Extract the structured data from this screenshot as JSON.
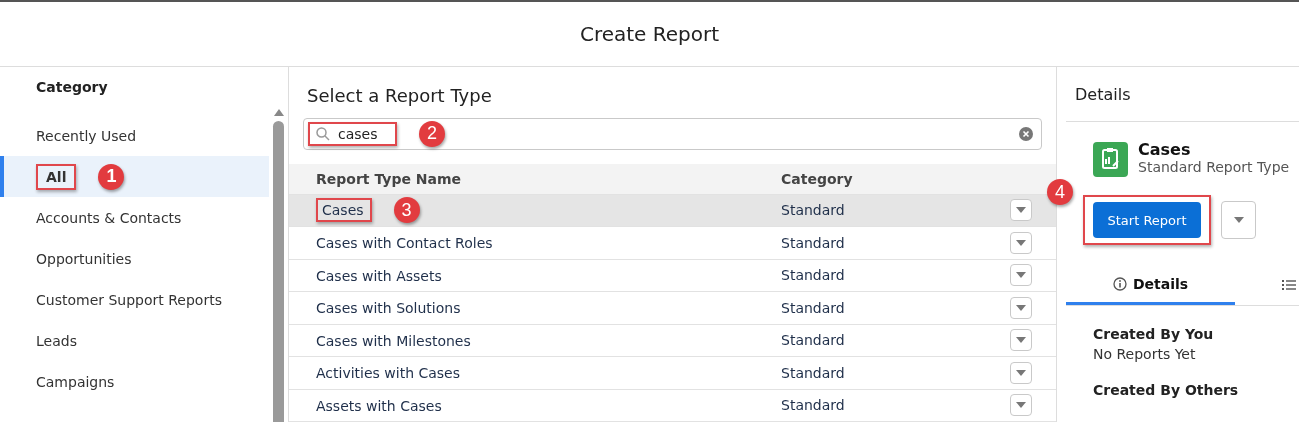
{
  "window": {
    "title": "Create Report"
  },
  "sidebar": {
    "heading": "Category",
    "items": [
      {
        "label": "Recently Used",
        "selected": false
      },
      {
        "label": "All",
        "selected": true,
        "callout": "1"
      },
      {
        "label": "Accounts & Contacts",
        "selected": false
      },
      {
        "label": "Opportunities",
        "selected": false
      },
      {
        "label": "Customer Support Reports",
        "selected": false
      },
      {
        "label": "Leads",
        "selected": false
      },
      {
        "label": "Campaigns",
        "selected": false
      }
    ]
  },
  "main": {
    "title": "Select a Report Type",
    "search": {
      "value": "cases",
      "callout": "2"
    },
    "table": {
      "columns": [
        "Report Type Name",
        "Category"
      ],
      "rows": [
        {
          "name": "Cases",
          "category": "Standard",
          "selected": true,
          "callout": "3"
        },
        {
          "name": "Cases with Contact Roles",
          "category": "Standard",
          "selected": false
        },
        {
          "name": "Cases with Assets",
          "category": "Standard",
          "selected": false
        },
        {
          "name": "Cases with Solutions",
          "category": "Standard",
          "selected": false
        },
        {
          "name": "Cases with Milestones",
          "category": "Standard",
          "selected": false
        },
        {
          "name": "Activities with Cases",
          "category": "Standard",
          "selected": false
        },
        {
          "name": "Assets with Cases",
          "category": "Standard",
          "selected": false
        }
      ]
    }
  },
  "details": {
    "heading": "Details",
    "name": "Cases",
    "subtitle": "Standard Report Type",
    "primary_button": {
      "label": "Start Report",
      "callout": "4"
    },
    "tabs": [
      {
        "label": "Details",
        "selected": true
      }
    ],
    "sections": [
      {
        "title": "Created By You",
        "text": "No Reports Yet"
      },
      {
        "title": "Created By Others"
      }
    ]
  }
}
